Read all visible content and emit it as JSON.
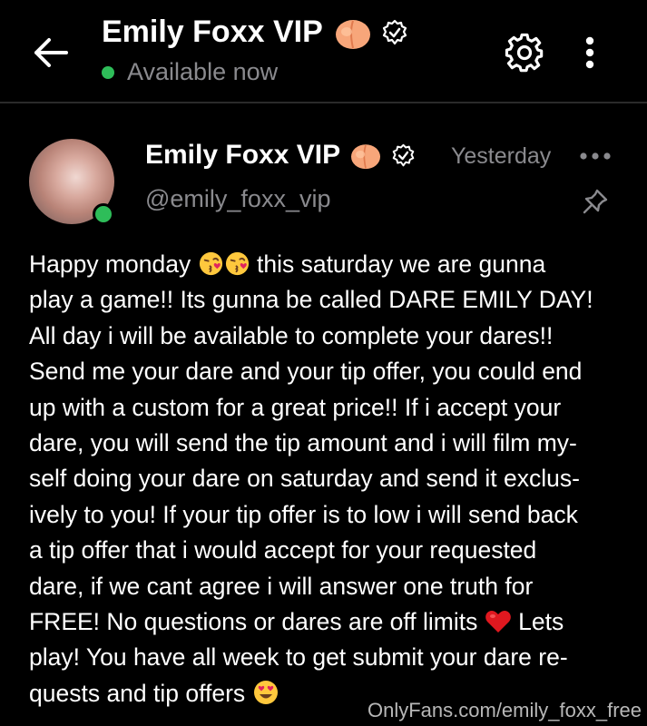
{
  "header": {
    "back_icon": "arrow-left-icon",
    "title": "Emily Foxx VIP",
    "status": "Available now",
    "status_color": "#2ebd59",
    "settings_icon": "gear-icon",
    "more_icon": "more-vertical-icon"
  },
  "post": {
    "author_name": "Emily Foxx VIP",
    "handle": "@emily_foxx_vip",
    "time": "Yesterday",
    "more_icon": "more-horizontal-icon",
    "pin_icon": "pin-icon",
    "body_lines": [
      [
        "Happy monday ",
        "this saturday we are gunna"
      ],
      "play a game!! Its gunna be called DARE EMILY DAY!",
      "All day i will be available to complete your dares!!",
      "Send me your dare and your tip offer, you could end",
      "up with a custom for a great price!! If i accept your",
      "dare, you will send the tip amount and i will film my-",
      "self doing your dare on saturday and send it exclus-",
      "ively to you! If your tip offer is to low i will send back",
      "a tip offer that i would accept for your requested",
      "dare, if we cant agree i will answer one truth for",
      [
        "FREE! No questions or dares are off limits ",
        "Lets"
      ],
      "play! You have all week to get submit your dare re-",
      [
        "quests and tip offers",
        ""
      ]
    ]
  },
  "watermark": "OnlyFans.com/emily_foxx_free",
  "colors": {
    "background": "#000000",
    "muted_text": "#8a8a8e",
    "online": "#2ebd59"
  }
}
